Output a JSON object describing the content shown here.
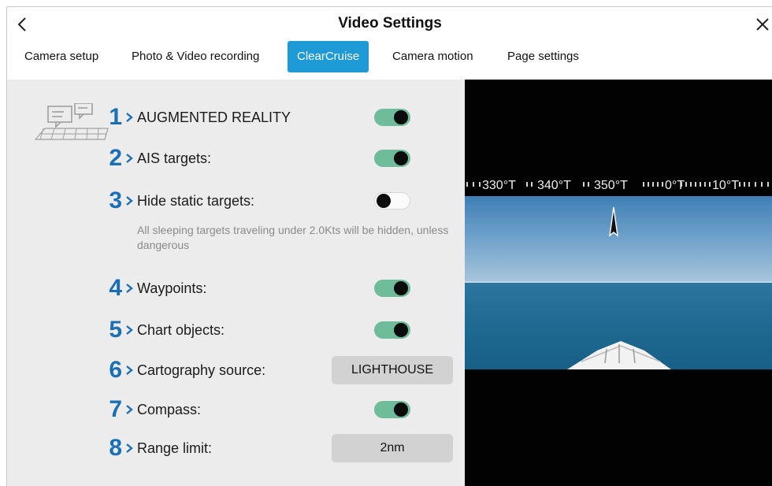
{
  "window": {
    "title": "Video Settings",
    "back_icon": "<",
    "close_icon": "×"
  },
  "tabs": [
    {
      "label": "Camera setup",
      "active": false
    },
    {
      "label": "Photo & Video recording",
      "active": false
    },
    {
      "label": "ClearCruise",
      "active": true
    },
    {
      "label": "Camera motion",
      "active": false
    },
    {
      "label": "Page settings",
      "active": false
    }
  ],
  "settings": {
    "augmented_reality": {
      "number": "1",
      "label": "AUGMENTED REALITY",
      "enabled": true
    },
    "ais_targets": {
      "number": "2",
      "label": "AIS targets:",
      "enabled": true
    },
    "hide_static_targets": {
      "number": "3",
      "label": "Hide static targets:",
      "enabled": false,
      "hint": "All sleeping targets traveling under 2.0Kts will be hidden, unless dangerous"
    },
    "waypoints": {
      "number": "4",
      "label": "Waypoints:",
      "enabled": true
    },
    "chart_objects": {
      "number": "5",
      "label": "Chart objects:",
      "enabled": true
    },
    "cartography_source": {
      "number": "6",
      "label": "Cartography source:",
      "value": "LIGHTHOUSE"
    },
    "compass": {
      "number": "7",
      "label": "Compass:",
      "enabled": true
    },
    "range_limit": {
      "number": "8",
      "label": "Range limit:",
      "value": "2nm"
    }
  },
  "video": {
    "compass_labels": [
      "330°T",
      "340°T",
      "350°T",
      "0°T",
      "10°T"
    ]
  },
  "colors": {
    "accent": "#1e9ad6",
    "number": "#1a6fb5",
    "toggle_on": "#6fbc9a",
    "toggle_off": "#fbfbfb"
  },
  "icons": {
    "back": "chevron-left-icon",
    "close": "close-icon",
    "ar": "augmented-reality-icon",
    "row_chevron": "chevron-right-icon"
  }
}
